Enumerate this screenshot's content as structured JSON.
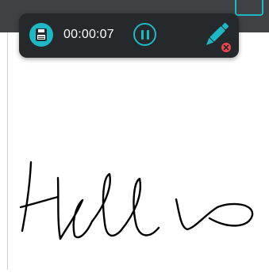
{
  "recorder": {
    "elapsed_time": "00:00:07"
  },
  "icons": {
    "save": "save-icon",
    "pause": "pause-icon",
    "pen": "pen-icon",
    "pen_status": "red-close-dot-icon"
  },
  "colors": {
    "accent": "#1fb7c4",
    "toolbar_bg": "#25292b",
    "topbar_bg": "#3e4244",
    "ink": "#000000",
    "status_red": "#e8474f"
  }
}
